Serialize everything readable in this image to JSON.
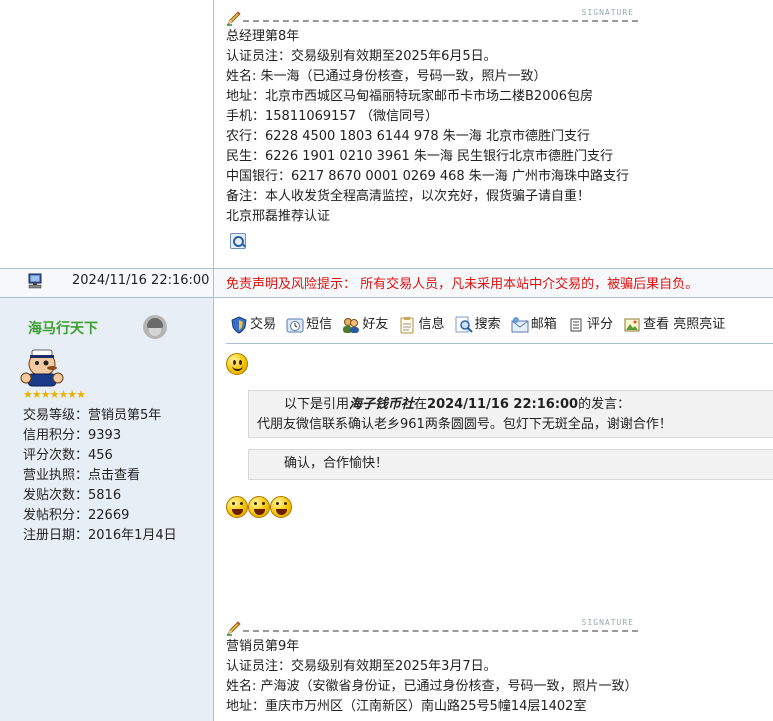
{
  "post1": {
    "signature_label": "SIGNATURE",
    "signature_lines": [
      "总经理第8年",
      "认证员注：交易级别有效期至2025年6月5日。",
      "姓名: 朱一海（已通过身份核查，号码一致，照片一致）",
      "地址：北京市西城区马甸福丽特玩家邮币卡市场二楼B2006包房",
      "手机：15811069157 （微信同号）",
      "农行：6228 4500 1803 6144 978 朱一海     北京市德胜门支行",
      "民生：6226 1901 0210 3961      朱一海 民生银行北京市德胜门支行",
      "中国银行：6217 8670 0001 0269 468   朱一海    广州市海珠中路支行",
      "备注：本人收发货全程高清监控，以次充好，假货骗子请自重！",
      "北京邢磊推荐认证"
    ]
  },
  "post2": {
    "datetime": "2024/11/16 22:16:00",
    "disclaimer": "免责声明及风险提示：  所有交易人员，凡未采用本站中介交易的，被骗后果自负。",
    "author": {
      "username": "海马行天下",
      "stars": "★★★★★★★",
      "profile": [
        {
          "label": "交易等级：",
          "value": "营销员第5年"
        },
        {
          "label": "信用积分：",
          "value": "9393"
        },
        {
          "label": "评分次数：",
          "value": "456"
        },
        {
          "label": "营业执照：",
          "value": "点击查看"
        },
        {
          "label": "发贴次数：",
          "value": "5816"
        },
        {
          "label": "发帖积分：",
          "value": "22669"
        },
        {
          "label": "注册日期：",
          "value": "2016年1月4日"
        }
      ]
    },
    "toolbar": [
      {
        "label": "交易",
        "icon": "shield-icon",
        "color": "#3b6fc4"
      },
      {
        "label": "短信",
        "icon": "clock-icon",
        "color": "#7a9bc8"
      },
      {
        "label": "好友",
        "icon": "users-icon",
        "color": "#5b8a3a"
      },
      {
        "label": "信息",
        "icon": "clipboard-icon",
        "color": "#c9a85b"
      },
      {
        "label": "搜索",
        "icon": "search-icon",
        "color": "#4a7fc1"
      },
      {
        "label": "邮箱",
        "icon": "mail-icon",
        "color": "#6aa0d8"
      },
      {
        "label": "评分",
        "icon": "list-icon",
        "color": "#444444"
      },
      {
        "label": "查看 亮照亮证",
        "icon": "image-icon",
        "color": "#5d9b3a"
      }
    ],
    "quote": {
      "intro_prefix": "以下是引用",
      "quoted_user": "海子钱币社",
      "intro_mid": "在",
      "quoted_time": "2024/11/16 22:16:00",
      "intro_suffix": "的发言：",
      "quoted_text": "代朋友微信联系确认老乡961两条圆圆号。包灯下无斑全品，谢谢合作！"
    },
    "reply": "确认，合作愉快！",
    "signature_label": "SIGNATURE",
    "signature_lines": [
      "营销员第9年",
      "认证员注：交易级别有效期至2025年3月7日。",
      "姓名: 产海波（安徽省身份证，已通过身份核查，号码一致，照片一致）",
      "地址：重庆市万州区（江南新区）南山路25号5幢14层1402室"
    ]
  }
}
